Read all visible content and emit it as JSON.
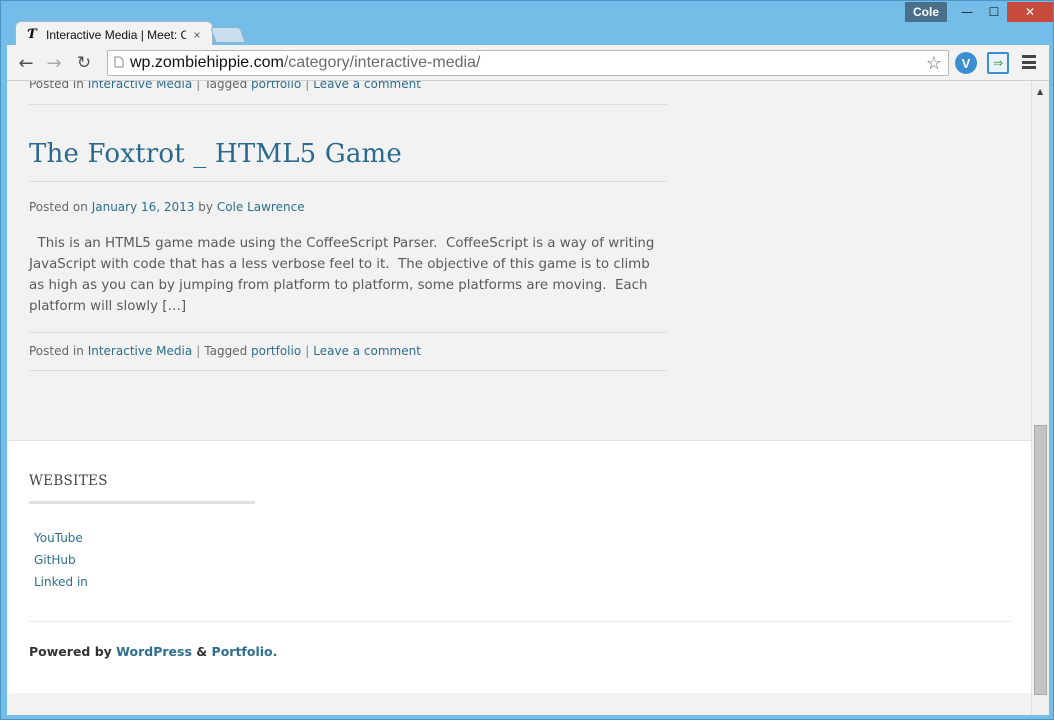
{
  "browser": {
    "tab_title": "Interactive Media | Meet: C",
    "tab_close": "×",
    "favicon_glyph": "Ƭ",
    "user_name": "Cole",
    "window_buttons": {
      "minimize": "—",
      "maximize": "☐",
      "close": "✕"
    },
    "nav": {
      "back": "←",
      "forward": "→",
      "reload": "↻"
    },
    "url_host": "wp.zombiehippie.com",
    "url_path": "/category/interactive-media/",
    "star": "☆",
    "ext_v_label": "V",
    "ext_cast_label": "⇒"
  },
  "prev_post_meta": {
    "posted_in_label": "Posted in",
    "category": "Interactive Media",
    "tagged_label": "Tagged",
    "tag": "portfolio",
    "comment_link": "Leave a comment",
    "separator": "|"
  },
  "post": {
    "title": "The Foxtrot _ HTML5 Game",
    "posted_on_label": "Posted on",
    "date": "January 16, 2013",
    "by_label": "by",
    "author": "Cole Lawrence",
    "excerpt": "  This is an HTML5 game made using the CoffeeScript Parser.  CoffeeScript is a way of writing JavaScript with code that has a less verbose feel to it.  The objective of this game is to climb as high as you can by jumping from platform to platform, some platforms are moving.  Each platform will slowly […]",
    "posted_in_label": "Posted in",
    "category": "Interactive Media",
    "tagged_label": "Tagged",
    "tag": "portfolio",
    "comment_link": "Leave a comment",
    "separator": "|"
  },
  "footer": {
    "widget_title": "WEBSITES",
    "links": [
      "YouTube",
      "GitHub",
      "Linked in"
    ],
    "powered_by_label": "Powered by",
    "wordpress": "WordPress",
    "amp": "&",
    "theme": "Portfolio."
  },
  "colors": {
    "link": "#2f6e8e",
    "chrome_frame": "#74bde8",
    "close_button": "#c74b3b"
  }
}
